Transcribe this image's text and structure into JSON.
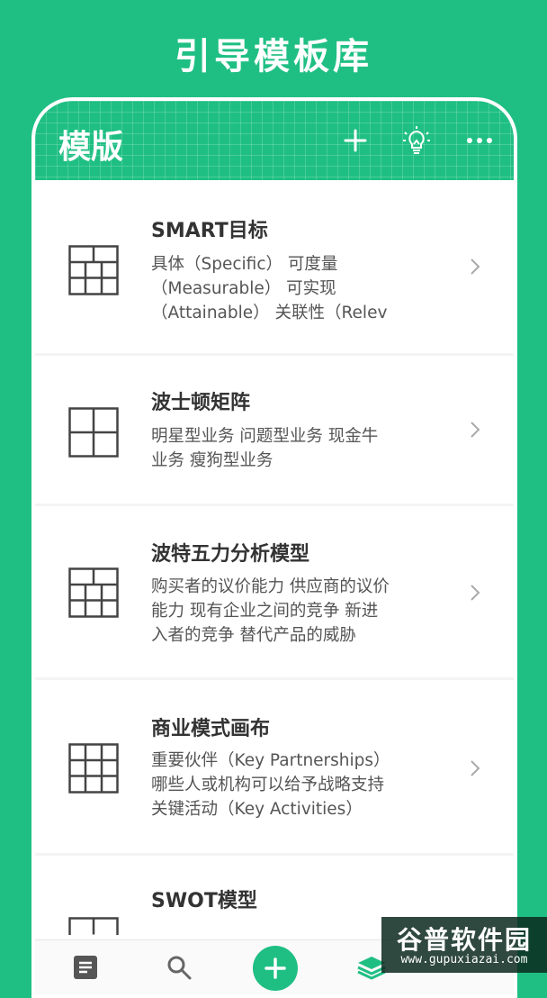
{
  "promo": {
    "title": "引导模板库"
  },
  "appbar": {
    "title": "模版",
    "icons": [
      "plus-icon",
      "lightbulb-icon",
      "more-icon"
    ]
  },
  "templates": [
    {
      "title": "SMART目标",
      "description": "具体（Specific）  可度量\n（Measurable）  可实现\n（Attainable）  关联性（Relev",
      "grid": "2-3-3"
    },
    {
      "title": "波士顿矩阵",
      "description": "明星型业务  问题型业务  现金牛\n业务  瘦狗型业务",
      "grid": "2x2"
    },
    {
      "title": "波特五力分析模型",
      "description": "购买者的议价能力  供应商的议价\n能力  现有企业之间的竞争  新进\n入者的竞争  替代产品的威胁",
      "grid": "2-3-3"
    },
    {
      "title": "商业模式画布",
      "description": "重要伙伴（Key Partnerships）\n哪些人或机构可以给予战略支持\n关键活动（Key Activities）",
      "grid": "3x3"
    },
    {
      "title": "SWOT模型",
      "description": "",
      "grid": "partial"
    }
  ],
  "tabbar": {
    "tabs": [
      "notes-icon",
      "search-icon",
      "add-icon",
      "layers-icon"
    ]
  },
  "watermark": {
    "main": "谷普软件园",
    "sub": "www.gupuxiazai.com"
  },
  "colors": {
    "accent": "#1fbf83",
    "text": "#333333"
  }
}
